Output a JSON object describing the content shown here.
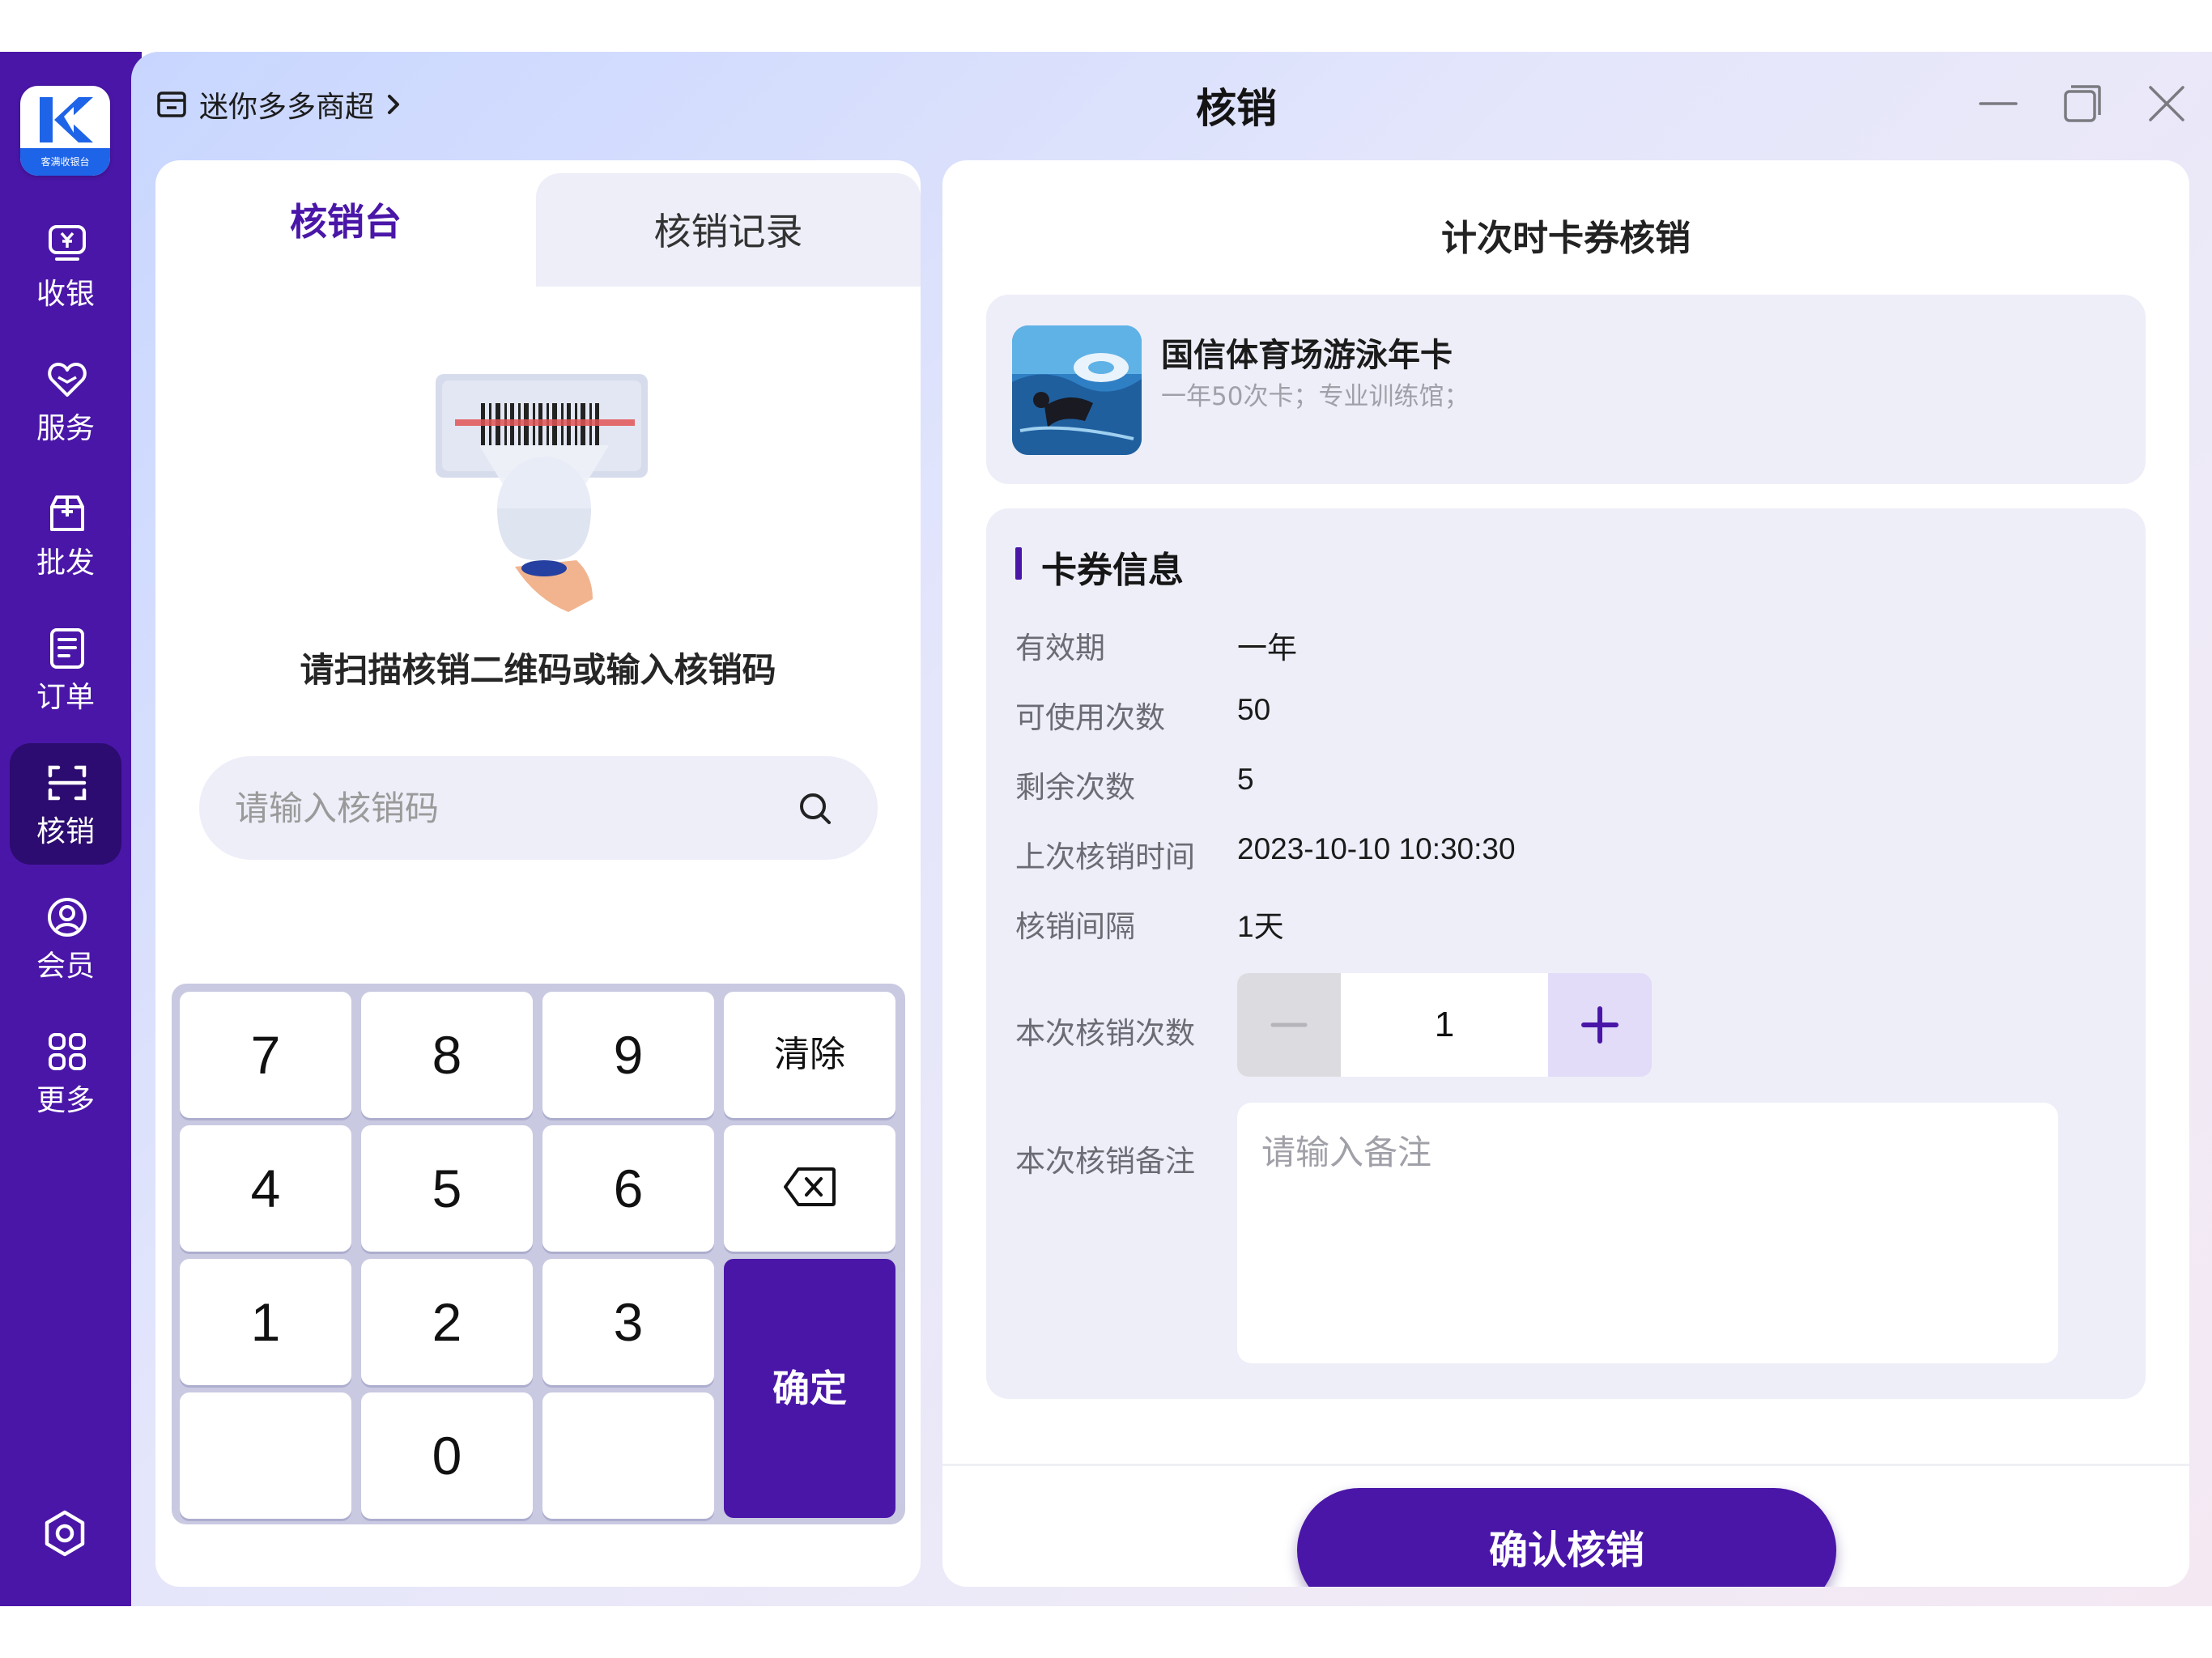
{
  "app": {
    "logo_text": "客满收银台",
    "store_name": "迷你多多商超",
    "page_title": "核销"
  },
  "sidebar": {
    "items": [
      {
        "label": "收银",
        "icon": "cashier-icon"
      },
      {
        "label": "服务",
        "icon": "heart-icon"
      },
      {
        "label": "批发",
        "icon": "box-icon"
      },
      {
        "label": "订单",
        "icon": "order-icon"
      },
      {
        "label": "核销",
        "icon": "scan-icon",
        "active": true
      },
      {
        "label": "会员",
        "icon": "member-icon"
      },
      {
        "label": "更多",
        "icon": "grid-icon"
      }
    ]
  },
  "left": {
    "tabs": [
      {
        "label": "核销台",
        "active": true
      },
      {
        "label": "核销记录",
        "active": false
      }
    ],
    "scan_hint": "请扫描核销二维码或输入核销码",
    "input_placeholder": "请输入核销码",
    "keypad": {
      "keys": [
        "7",
        "8",
        "9",
        "4",
        "5",
        "6",
        "1",
        "2",
        "3",
        "0"
      ],
      "clear_label": "清除",
      "confirm_label": "确定"
    }
  },
  "right": {
    "title": "计次时卡券核销",
    "product": {
      "name": "国信体育场游泳年卡",
      "desc": "一年50次卡；专业训练馆；"
    },
    "info": {
      "section_title": "卡券信息",
      "rows": [
        {
          "label": "有效期",
          "value": "一年"
        },
        {
          "label": "可使用次数",
          "value": "50"
        },
        {
          "label": "剩余次数",
          "value": "5"
        },
        {
          "label": "上次核销时间",
          "value": "2023-10-10 10:30:30"
        },
        {
          "label": "核销间隔",
          "value": "1天"
        }
      ],
      "count_label": "本次核销次数",
      "count_value": "1",
      "remark_label": "本次核销备注",
      "remark_placeholder": "请输入备注"
    },
    "confirm_label": "确认核销"
  },
  "colors": {
    "primary": "#4a16a8",
    "sidebar_active": "#2c0c70",
    "panel_bg": "#edeef8"
  }
}
